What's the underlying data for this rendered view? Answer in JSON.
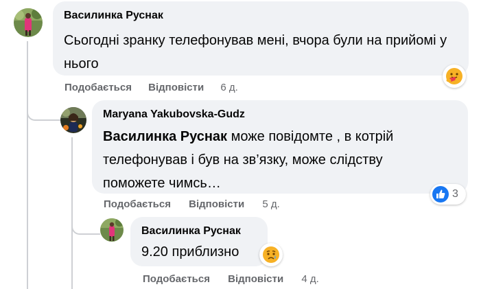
{
  "comments": [
    {
      "author": "Василинка Руснак",
      "text": "Сьогодні зранку телефонував мені, вчора були на прийомі у нього",
      "reaction": "care-reaction-icon",
      "actions": {
        "like": "Подобається",
        "reply": "Відповісти",
        "time": "6 д."
      }
    },
    {
      "author": "Maryana Yakubovska-Gudz",
      "mention": "Василинка Руснак",
      "text": " може повідомте , в котрій телефонував і був на зв’язку, може слідству поможете чимсь…",
      "reaction": "like-reaction-icon",
      "reaction_count": "3",
      "actions": {
        "like": "Подобається",
        "reply": "Відповісти",
        "time": "5 д."
      }
    },
    {
      "author": "Василинка Руснак",
      "text": "9.20 приблизно",
      "reaction": "sad-reaction-icon",
      "actions": {
        "like": "Подобається",
        "reply": "Відповісти",
        "time": "4 д."
      }
    }
  ],
  "colors": {
    "bubble": "#f0f2f5",
    "meta": "#65676b",
    "like_blue": "#1877f2",
    "line": "#ced0d4"
  }
}
